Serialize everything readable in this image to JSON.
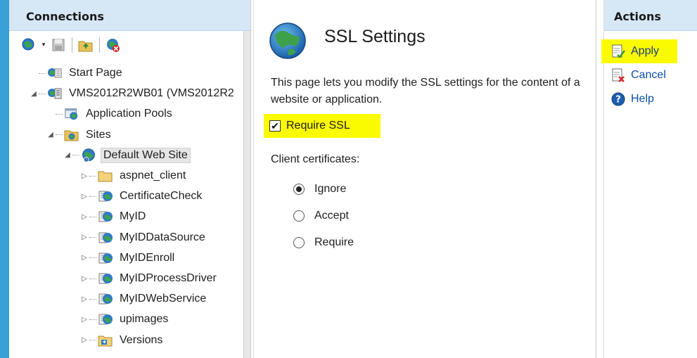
{
  "connections": {
    "title": "Connections",
    "toolbar": [
      {
        "icon": "connect-globe-icon"
      },
      {
        "icon": "save-icon"
      },
      {
        "icon": "up-folder-icon"
      },
      {
        "icon": "disconnect-icon"
      }
    ],
    "tree": [
      {
        "label": "Start Page",
        "icon": "start-page-icon",
        "depth": 0,
        "expander": ""
      },
      {
        "label": "VMS2012R2WB01 (VMS2012R2",
        "icon": "server-icon",
        "depth": 0,
        "expander": "◢"
      },
      {
        "label": "Application Pools",
        "icon": "app-pools-icon",
        "depth": 1,
        "expander": ""
      },
      {
        "label": "Sites",
        "icon": "sites-folder-icon",
        "depth": 1,
        "expander": "◢"
      },
      {
        "label": "Default Web Site",
        "icon": "website-globe-icon",
        "depth": 2,
        "expander": "◢",
        "selected": true
      },
      {
        "label": "aspnet_client",
        "icon": "folder-icon",
        "depth": 3,
        "expander": "▷"
      },
      {
        "label": "CertificateCheck",
        "icon": "web-app-icon",
        "depth": 3,
        "expander": "▷"
      },
      {
        "label": "MyID",
        "icon": "web-app-icon",
        "depth": 3,
        "expander": "▷"
      },
      {
        "label": "MyIDDataSource",
        "icon": "web-app-icon",
        "depth": 3,
        "expander": "▷"
      },
      {
        "label": "MyIDEnroll",
        "icon": "web-app-icon",
        "depth": 3,
        "expander": "▷"
      },
      {
        "label": "MyIDProcessDriver",
        "icon": "web-app-icon",
        "depth": 3,
        "expander": "▷"
      },
      {
        "label": "MyIDWebService",
        "icon": "web-app-icon",
        "depth": 3,
        "expander": "▷"
      },
      {
        "label": "upimages",
        "icon": "web-app-icon",
        "depth": 3,
        "expander": "▷"
      },
      {
        "label": "Versions",
        "icon": "virtual-dir-icon",
        "depth": 3,
        "expander": "▷"
      }
    ]
  },
  "main": {
    "title": "SSL Settings",
    "description": "This page lets you modify the SSL settings for the content of a website or application.",
    "require_ssl_label": "Require SSL",
    "require_ssl_checked": true,
    "client_cert_label": "Client certificates:",
    "client_cert_options": [
      {
        "label": "Ignore",
        "selected": true
      },
      {
        "label": "Accept",
        "selected": false
      },
      {
        "label": "Require",
        "selected": false
      }
    ]
  },
  "actions": {
    "title": "Actions",
    "items": [
      {
        "label": "Apply",
        "icon": "apply-icon",
        "highlight": true
      },
      {
        "label": "Cancel",
        "icon": "cancel-icon",
        "highlight": false
      },
      {
        "label": "Help",
        "icon": "help-icon",
        "highlight": false
      }
    ]
  },
  "colors": {
    "highlight": "#fafa00",
    "pane_header": "#d6e7f6",
    "accent": "#3aa0d8",
    "link": "#0b4fa8"
  }
}
